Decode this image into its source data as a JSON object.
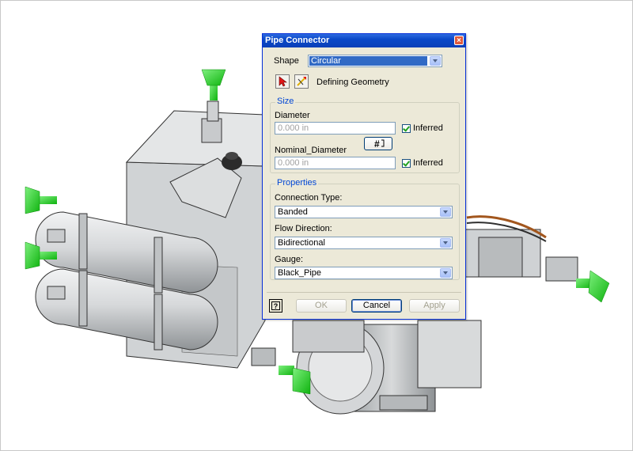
{
  "dialog": {
    "title": "Pipe Connector",
    "close_glyph": "×",
    "shape_label": "Shape",
    "shape_value": "Circular",
    "defining_geometry_label": "Defining Geometry",
    "size": {
      "title": "Size",
      "diameter_label": "Diameter",
      "diameter_value": "0.000 in",
      "diameter_inferred_label": "Inferred",
      "nominal_diameter_label": "Nominal_Diameter",
      "nominal_diameter_value": "0.000 in",
      "nominal_inferred_label": "Inferred"
    },
    "properties": {
      "title": "Properties",
      "connection_type_label": "Connection Type:",
      "connection_type_value": "Banded",
      "flow_direction_label": "Flow Direction:",
      "flow_direction_value": "Bidirectional",
      "gauge_label": "Gauge:",
      "gauge_value": "Black_Pipe"
    },
    "help_glyph": "?",
    "ok_label": "OK",
    "cancel_label": "Cancel",
    "apply_label": "Apply"
  },
  "colors": {
    "title_bar": "#0a48c8",
    "dialog_bg": "#ece9d8",
    "connector_green": "#22cc22",
    "model_gray": "#d4d6d8"
  }
}
